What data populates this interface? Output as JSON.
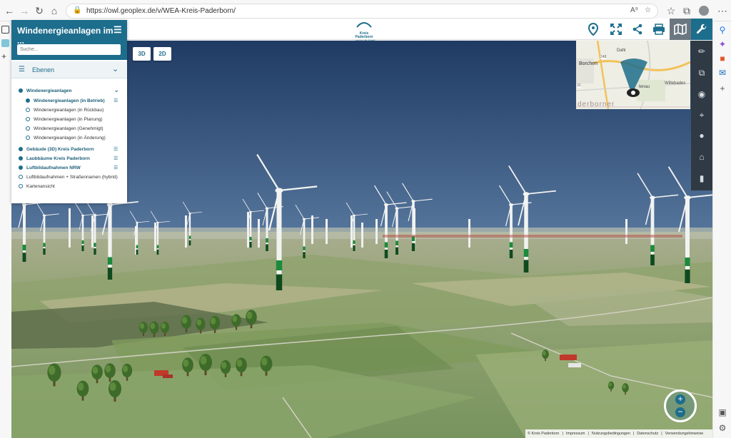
{
  "browser": {
    "url": "https://owl.geoplex.de/v/WEA-Kreis-Paderborn/",
    "nav_icons": [
      "back-icon",
      "forward-icon",
      "reload-icon",
      "home-icon"
    ]
  },
  "header": {
    "logo_text_line1": "Kreis",
    "logo_text_line2": "Paderborn",
    "logo_tagline": "...und los die Arbeit!",
    "icons": [
      "location-pin-icon",
      "fullscreen-icon",
      "share-icon",
      "print-icon",
      "map-icon",
      "wrench-icon"
    ]
  },
  "panel": {
    "title": "Windenergieanlagen im ...",
    "search_placeholder": "Suche...",
    "section_label": "Ebenen",
    "layers": [
      {
        "label": "Windenergieanlagen",
        "level": 0,
        "active": true,
        "bold": true,
        "expanded": true
      },
      {
        "label": "Windenergieanlagen (in Betrieb)",
        "level": 1,
        "active": true,
        "bold": true,
        "menu": true
      },
      {
        "label": "Windenergieanlagen (in Rückbau)",
        "level": 1,
        "active": false
      },
      {
        "label": "Windenergieanlagen (in Planung)",
        "level": 1,
        "active": false
      },
      {
        "label": "Windenergieanlagen (Genehmigt)",
        "level": 1,
        "active": false
      },
      {
        "label": "Windenergieanlagen (in Änderung)",
        "level": 1,
        "active": false
      },
      {
        "label": "Gebäude (3D) Kreis Paderborn",
        "level": 0,
        "active": true,
        "bold": true,
        "menu": true
      },
      {
        "label": "Laubbäume Kreis Paderborn",
        "level": 0,
        "active": true,
        "bold": true,
        "menu": true
      },
      {
        "label": "Luftbildaufnahmen NRW",
        "level": 0,
        "active": true,
        "bold": true,
        "menu": true
      },
      {
        "label": "Luftbildaufnahmen + Straßennamen (hybrid)",
        "level": 0,
        "active": false
      },
      {
        "label": "Kartenansicht",
        "level": 0,
        "active": false
      }
    ]
  },
  "view_toggle": {
    "btn_3d": "3D",
    "btn_2d": "2D"
  },
  "minimap": {
    "labels": [
      "Borchen",
      "Dahl",
      "Willebades",
      "tenau",
      "derborner"
    ],
    "road_numbers": [
      "248",
      "33"
    ]
  },
  "right_toolbar": {
    "icons": [
      "wrench-icon",
      "ruler-icon",
      "layers-3d-icon",
      "eye-icon",
      "target-icon",
      "globe-icon",
      "home-icon",
      "clapper-icon"
    ]
  },
  "footer": {
    "links": [
      "© Kreis Paderborn",
      "Impressum",
      "Nutzungsbedingungen",
      "Datenschutz",
      "Verwendungshinweise"
    ]
  },
  "colors": {
    "primary": "#1d6d8c",
    "toolbar": "#2f3a44"
  }
}
